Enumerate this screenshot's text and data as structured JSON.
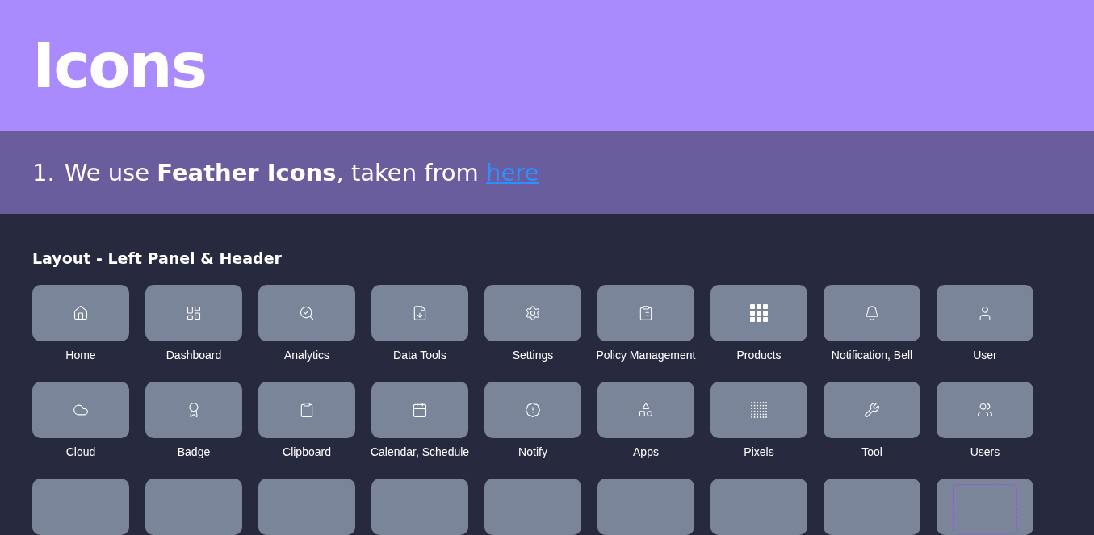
{
  "title": "Icons",
  "note": {
    "number": "1.",
    "text": "We use **Feather Icons**, taken from",
    "link": "here"
  },
  "section": {
    "title": "Layout - Left Panel & Header",
    "icons": [
      {
        "label": "Home"
      },
      {
        "label": "Dashboard"
      },
      {
        "label": "Analytics"
      },
      {
        "label": "Data Tools"
      },
      {
        "label": "Settings"
      },
      {
        "label": "Policy Management"
      },
      {
        "label": "Products"
      },
      {
        "label": "Notification, Bell"
      },
      {
        "label": "User"
      },
      {
        "label": "Cloud"
      },
      {
        "label": "Badge"
      },
      {
        "label": "Clipboard"
      },
      {
        "label": "Calendar, Schedule"
      },
      {
        "label": "Notify"
      },
      {
        "label": "Apps"
      },
      {
        "label": "Pixels"
      },
      {
        "label": "Tool"
      },
      {
        "label": "Users"
      }
    ],
    "partial_tiles": [
      {
        "outlined": false
      },
      {
        "outlined": false
      },
      {
        "outlined": false
      },
      {
        "outlined": false
      },
      {
        "outlined": false
      },
      {
        "outlined": false
      },
      {
        "outlined": false
      },
      {
        "outlined": false
      },
      {
        "outlined": true
      }
    ]
  }
}
